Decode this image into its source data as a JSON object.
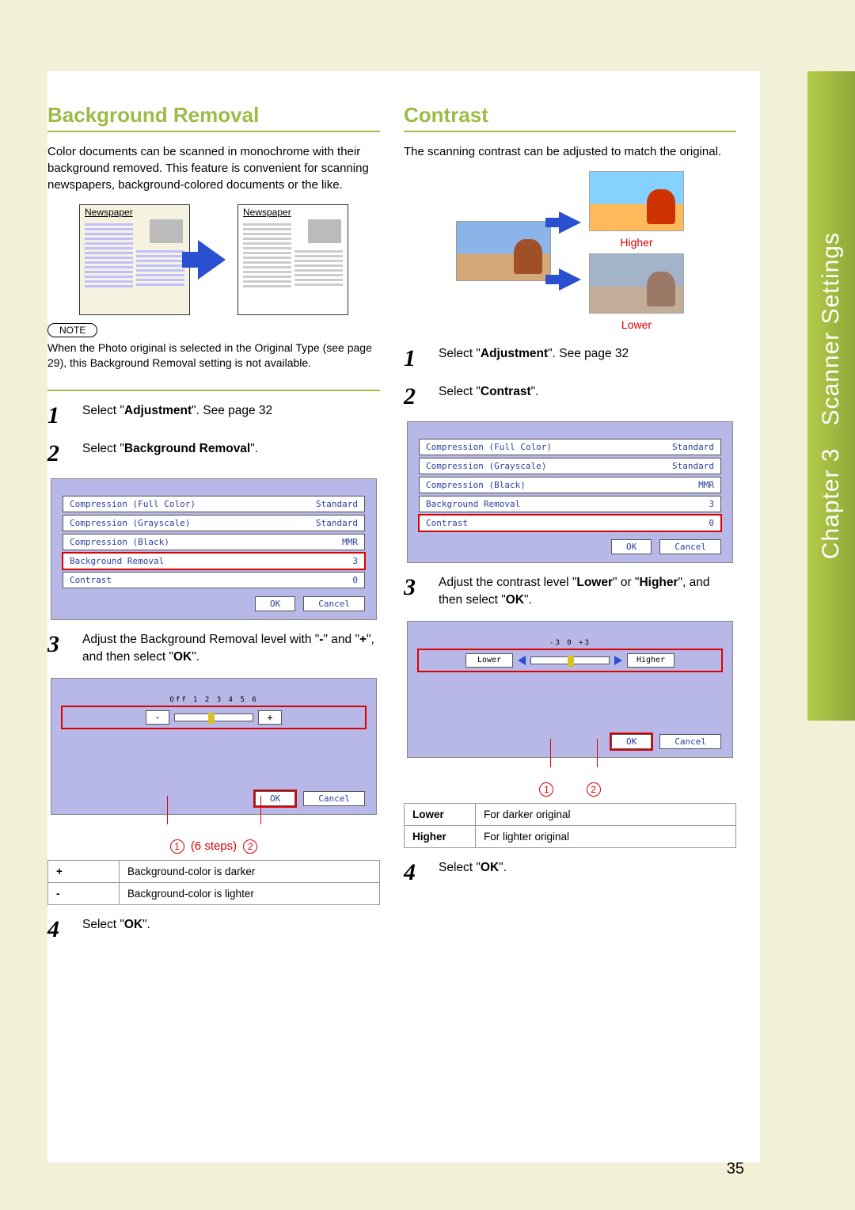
{
  "sidebar": {
    "chapter_label": "Chapter",
    "chapter_num": "3",
    "chapter_title": "Scanner Settings"
  },
  "page_number": "35",
  "bg_removal": {
    "title": "Background Removal",
    "intro": "Color documents can be scanned in monochrome with their background removed. This feature is convenient for scanning newspapers, background-colored documents or the like.",
    "np_label_a": "Newspaper",
    "np_label_b": "Newspaper",
    "note_badge": "NOTE",
    "note_text": "When the Photo original is selected in the Original Type (see page 29), this Background Removal setting is not available.",
    "steps": {
      "s1_prefix": "Select \"",
      "s1_bold": "Adjustment",
      "s1_suffix": "\". See page 32",
      "s2_prefix": "Select \"",
      "s2_bold": "Background Removal",
      "s2_suffix": "\".",
      "s3_a": "Adjust the Background Removal level with \"",
      "s3_b1": "-",
      "s3_b": "\" and \"",
      "s3_b2": "+",
      "s3_c": "\", and then select \"",
      "s3_b3": "OK",
      "s3_d": "\".",
      "s4_prefix": "Select \"",
      "s4_bold": "OK",
      "s4_suffix": "\"."
    },
    "ui": {
      "rows": [
        {
          "label": "Compression (Full Color)",
          "value": "Standard"
        },
        {
          "label": "Compression (Grayscale)",
          "value": "Standard"
        },
        {
          "label": "Compression (Black)",
          "value": "MMR"
        },
        {
          "label": "Background Removal",
          "value": "3"
        },
        {
          "label": "Contrast",
          "value": "0"
        }
      ],
      "ok": "OK",
      "cancel": "Cancel",
      "highlight_index": 3
    },
    "slider": {
      "ticks": "Off 1  2  3  4  5  6",
      "minus": "-",
      "plus": "+",
      "ok": "OK",
      "cancel": "Cancel"
    },
    "callout": {
      "num1": "1",
      "steps_text": "(6 steps)",
      "num2": "2"
    },
    "table": {
      "r1k": "+",
      "r1v": "Background-color is darker",
      "r2k": "-",
      "r2v": "Background-color is lighter"
    }
  },
  "contrast": {
    "title": "Contrast",
    "intro": "The scanning contrast can be adjusted to match the original.",
    "higher_lbl": "Higher",
    "lower_lbl": "Lower",
    "steps": {
      "s1_prefix": "Select \"",
      "s1_bold": "Adjustment",
      "s1_suffix": "\". See page 32",
      "s2_prefix": "Select \"",
      "s2_bold": "Contrast",
      "s2_suffix": "\".",
      "s3_a": "Adjust the contrast level \"",
      "s3_b1": "Lower",
      "s3_b": "\" or \"",
      "s3_b2": "Higher",
      "s3_c": "\", and then select \"",
      "s3_b3": "OK",
      "s3_d": "\".",
      "s4_prefix": "Select \"",
      "s4_bold": "OK",
      "s4_suffix": "\"."
    },
    "ui": {
      "rows": [
        {
          "label": "Compression (Full Color)",
          "value": "Standard"
        },
        {
          "label": "Compression (Grayscale)",
          "value": "Standard"
        },
        {
          "label": "Compression (Black)",
          "value": "MMR"
        },
        {
          "label": "Background Removal",
          "value": "3"
        },
        {
          "label": "Contrast",
          "value": "0"
        }
      ],
      "ok": "OK",
      "cancel": "Cancel",
      "highlight_index": 4
    },
    "slider": {
      "ticks": "-3     0     +3",
      "lower": "Lower",
      "higher": "Higher",
      "ok": "OK",
      "cancel": "Cancel"
    },
    "callout": {
      "num1": "1",
      "num2": "2"
    },
    "table": {
      "r1k": "Lower",
      "r1v": "For darker original",
      "r2k": "Higher",
      "r2v": "For lighter original"
    }
  }
}
